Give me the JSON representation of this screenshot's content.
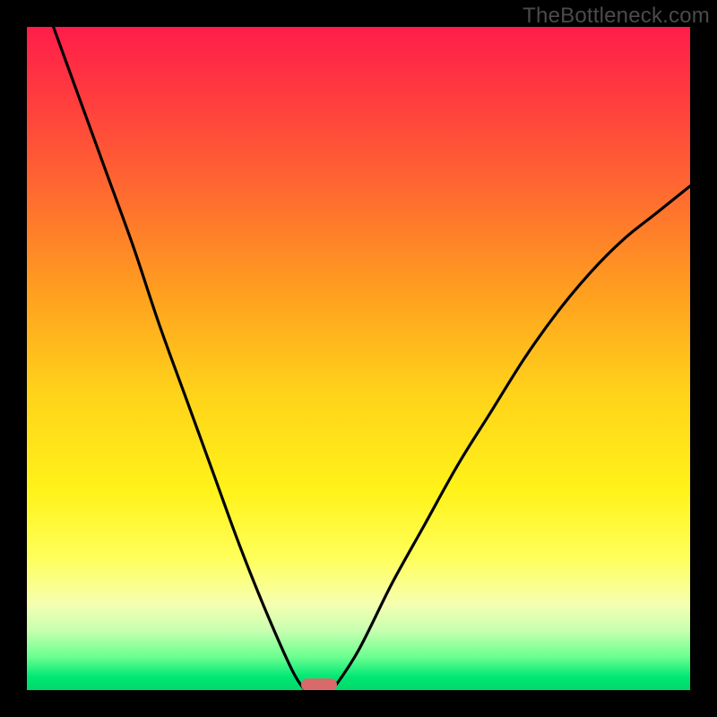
{
  "watermark": "TheBottleneck.com",
  "chart_data": {
    "type": "line",
    "title": "",
    "xlabel": "",
    "ylabel": "",
    "xlim": [
      0,
      1
    ],
    "ylim": [
      0,
      1
    ],
    "series": [
      {
        "name": "left-curve",
        "x": [
          0.04,
          0.08,
          0.12,
          0.16,
          0.2,
          0.24,
          0.28,
          0.32,
          0.36,
          0.4,
          0.42
        ],
        "y": [
          1.0,
          0.89,
          0.78,
          0.67,
          0.55,
          0.44,
          0.33,
          0.22,
          0.12,
          0.03,
          0.0
        ]
      },
      {
        "name": "right-curve",
        "x": [
          0.46,
          0.5,
          0.55,
          0.6,
          0.65,
          0.7,
          0.75,
          0.8,
          0.85,
          0.9,
          0.95,
          1.0
        ],
        "y": [
          0.0,
          0.06,
          0.16,
          0.25,
          0.34,
          0.42,
          0.5,
          0.57,
          0.63,
          0.68,
          0.72,
          0.76
        ]
      }
    ],
    "minimum_x": 0.44,
    "gradient_stops": [
      {
        "pos": 0.0,
        "color": "#ff1d4a"
      },
      {
        "pos": 0.55,
        "color": "#ffd21a"
      },
      {
        "pos": 0.8,
        "color": "#ffff5a"
      },
      {
        "pos": 1.0,
        "color": "#00d868"
      }
    ],
    "marker": {
      "color": "#d96a6a",
      "shape": "pill"
    }
  }
}
